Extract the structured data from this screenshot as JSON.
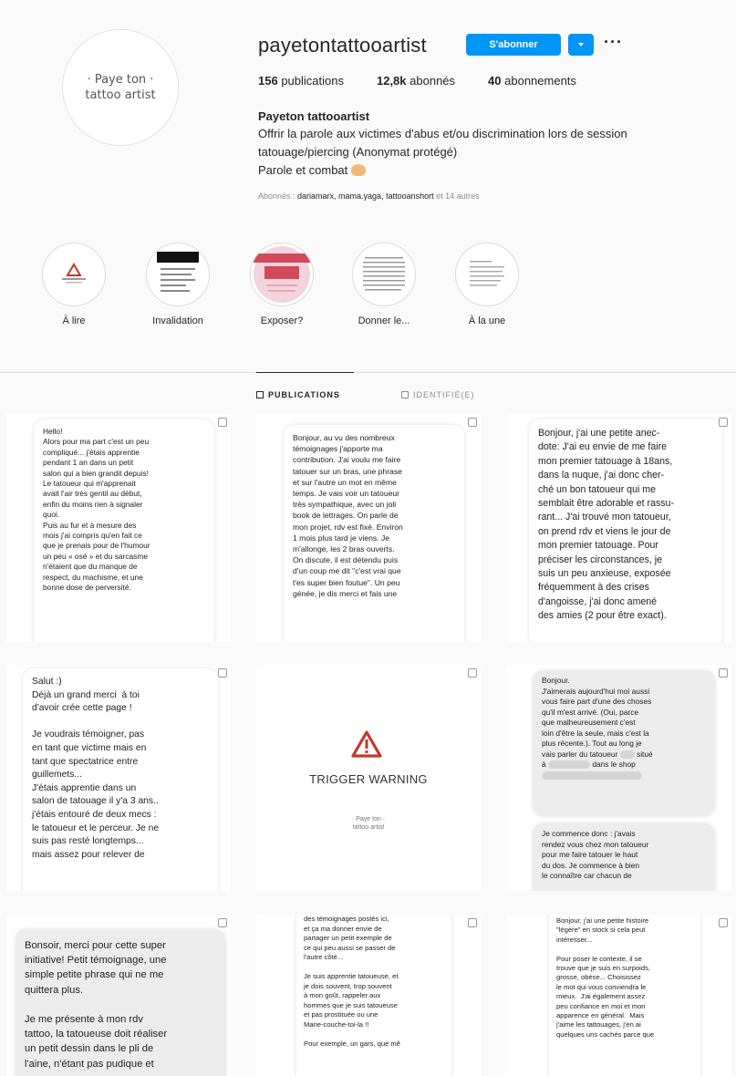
{
  "profile": {
    "avatar_line1": "Paye ton",
    "avatar_line2": "tattoo artist",
    "username": "payetontattooartist",
    "follow_label": "S'abonner",
    "more_label": "···",
    "stats": {
      "posts_count": "156",
      "posts_label": "publications",
      "followers_count": "12,8k",
      "followers_label": "abonnés",
      "following_count": "40",
      "following_label": "abonnements"
    },
    "bio_name": "Payeton tattooartist",
    "bio_line1": "Offrir la parole aux victimes d'abus et/ou discrimination lors de session",
    "bio_line2": "tatouage/piercing (Anonymat protégé)",
    "bio_line3": "Parole et combat",
    "followed_prefix": "Abonnés : ",
    "followed_names": "dariamarx, mama.yaga, tattooanshort",
    "followed_suffix": " et 14 autres"
  },
  "highlights": [
    {
      "label": "À lire"
    },
    {
      "label": "Invalidation"
    },
    {
      "label": "Exposer?"
    },
    {
      "label": "Donner le..."
    },
    {
      "label": "À la une"
    }
  ],
  "tabs": {
    "posts_label": "PUBLICATIONS",
    "tagged_label": "IDENTIFIÉ(E)"
  },
  "colors": {
    "accent": "#0095f6",
    "warning_red": "#c0392b"
  },
  "posts": [
    {
      "text": "Hello!\nAlors pour ma part c'est un peu\ncompliqué... j'étais apprentie\npendant 1 an dans un petit\nsalon qui a bien grandit depuis!\nLe tatoueur qui m'apprenait\navait l'air très gentil au début,\nenfin du moins rien à signaler\nquoi.\nPuis au fur et à mesure des\nmois j'ai compris qu'en fait ce\nque je prenais pour de l'humour\nun peu « osé » et du sarcasme\nn'étaient que du manque de\nrespect, du machisme, et une\nbonne dose de perversité."
    },
    {
      "text": "Bonjour, au vu des nombreux\ntémoignages j'apporte ma\ncontribution. J'ai voulu me faire\ntatouer sur un bras, une phrase\net sur l'autre un mot en même\ntemps. Je vais voir un tatoueur\ntrès sympathique, avec un joli\nbook de lettrages. On parle de\nmon projet, rdv est fixé. Environ\n1 mois plus tard je viens. Je\nm'allonge, les 2 bras ouverts.\nOn discute, il est détendu puis\nd'un coup me dit \"c'est vrai que\nt'es super bien foutue\". Un peu\ngénée, je dis merci et fais une"
    },
    {
      "text": "Bonjour, j'ai une petite anec-\ndote: J'ai eu envie de me faire\nmon premier tatouage à 18ans,\ndans la nuque, j'ai donc cher-\nché un bon tatoueur qui me\nsemblait être adorable et rassu-\nrant... J'ai trouvé mon tatoueur,\non prend rdv et viens le jour de\nmon premier tatouage. Pour\npréciser les circonstances, je\nsuis un peu anxieuse, exposée\nfréquemment à des crises\nd'angoisse, j'ai donc amené\ndes amies (2 pour être exact)."
    },
    {
      "text": "Salut :)\nDéjà un grand merci  à toi\nd'avoir crée cette page !\n\nJe voudrais témoigner, pas\nen tant que victime mais en\ntant que spectatrice entre\nguillemets...\nJ'étais apprentie dans un\nsalon de tatouage il y'a 3 ans..\nj'étais entouré de deux mecs :\nle tatoueur et le perceur. Je ne\nsuis pas resté longtemps...\nmais assez pour relever de"
    },
    {
      "title": "TRIGGER WARNING",
      "logo_line1": "Paye ton",
      "logo_line2": "tattoo artist"
    },
    {
      "text": "Bonjour.\nJ'aimerais aujourd'hui moi aussi\nvous faire part d'une des choses\nqu'il m'est arrivé. (Oui, parce\nque malheureusement c'est\nloin d'être la seule, mais c'est la\nplus récente.). Tout au long je\nvais parler du tatoueur",
      "text_b": "situé",
      "text_c": "à",
      "text_d": "dans le shop",
      "text2": "Je commence donc : j'avais\nrendez vous chez mon tatoueur\npour me faire tatouer le haut\ndu dos. Je commence à bien\nle connaître car chacun de"
    },
    {
      "text": "Bonsoir, merci pour cette super\ninitiative! Petit témoignage, une\nsimple petite phrase qui ne me\nquittera plus.\n\nJe me présente à mon rdv\ntattoo, la tatoueuse doit réaliser\nun petit dessin dans le pli de\nl'aine, n'étant pas pudique et"
    },
    {
      "text": "des témoignages postés ici,\net ça ma donner envie de\npartager un petit exemple de\nce qui peu aussi se passer de\nl'autre côté...\n\nJe suis apprentie tatoueuse, et\nje dois souvent, trop souvent\nà mon goût, rappeler aux\nhommes que je suis tatoueuse\net pas prostituée ou une\nMarie-couche-toi-la !!\n\nPour exemple, un gars, que mê"
    },
    {
      "text": "Bonjour, j'ai une petite histoire\n\"légère\" en stock si cela peut\nintéresser...\n\nPour poser le contexte, il se\ntrouve que je suis en surpoids,\ngrosse, obèse... Choisissez\nle mot qui vous conviendra le\nmieux.  J'ai également assez\npeu confiance en moi et mon\napparence en général.  Mais\nj'aime les tattouages, j'en ai\nquelques uns cachés parce que"
    }
  ]
}
